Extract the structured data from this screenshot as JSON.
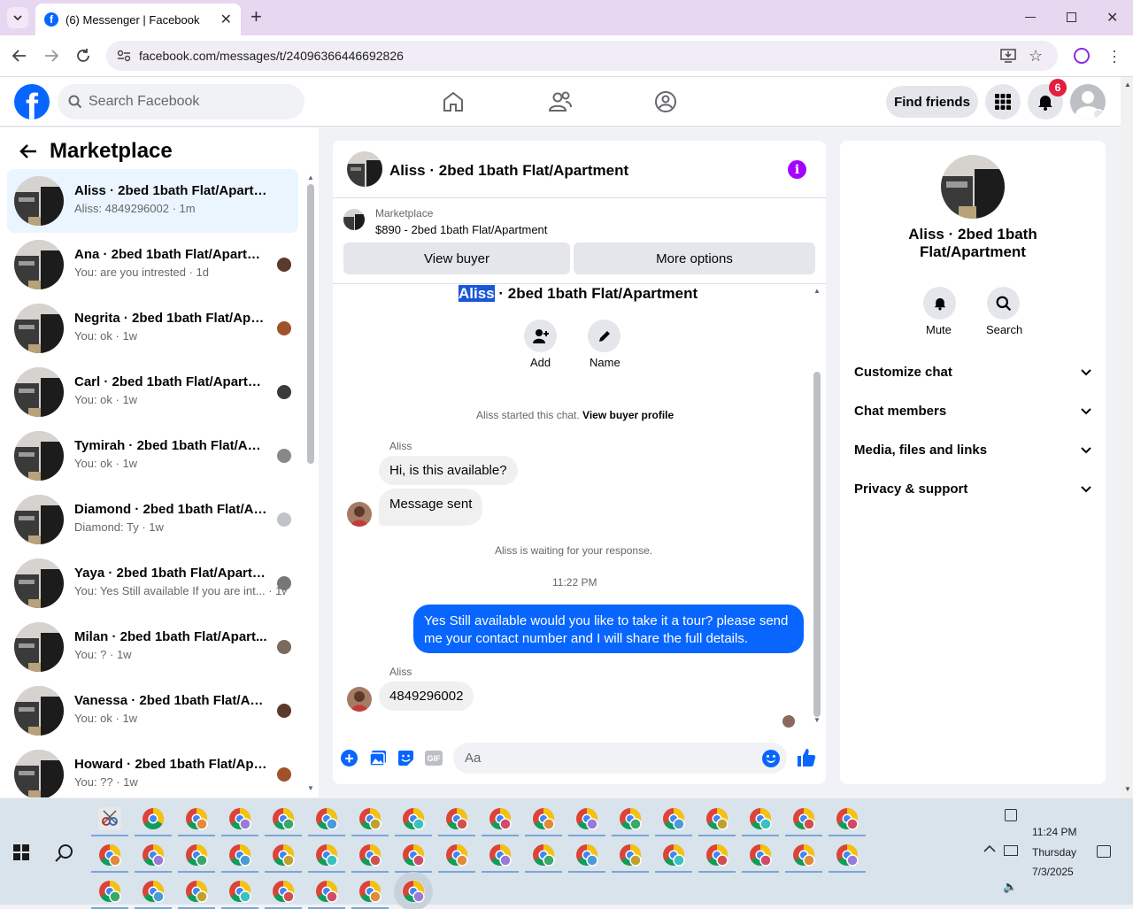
{
  "browser": {
    "tab_title": "(6) Messenger | Facebook",
    "url": "facebook.com/messages/t/24096366446692826"
  },
  "fb": {
    "search_placeholder": "Search Facebook",
    "find_friends": "Find friends",
    "notif_count": "6",
    "brand_color": "#0866ff"
  },
  "sidebar": {
    "title": "Marketplace",
    "conversations": [
      {
        "name": "Aliss · 2bed 1bath Flat/Apartment",
        "preview": "Aliss: 4849296002 · 1m"
      },
      {
        "name": "Ana · 2bed 1bath Flat/Apartm...",
        "preview": "You: are you intrested · 1d"
      },
      {
        "name": "Negrita · 2bed 1bath Flat/Apa...",
        "preview": "You: ok · 1w"
      },
      {
        "name": "Carl · 2bed 1bath Flat/Apartm...",
        "preview": "You: ok · 1w"
      },
      {
        "name": "Tymirah · 2bed 1bath Flat/Apa...",
        "preview": "You: ok · 1w"
      },
      {
        "name": "Diamond · 2bed 1bath Flat/Apar...",
        "preview": "Diamond: Ty · 1w"
      },
      {
        "name": "Yaya · 2bed 1bath Flat/Apartment",
        "preview": "You: Yes Still available If you are int... · 1w"
      },
      {
        "name": "Milan · 2bed 1bath Flat/Apart...",
        "preview": "You: ? · 1w"
      },
      {
        "name": "Vanessa · 2bed 1bath Flat/Apart...",
        "preview": "You: ok · 1w"
      },
      {
        "name": "Howard · 2bed 1bath Flat/Apart...",
        "preview": "You: ?? · 1w"
      }
    ]
  },
  "chat": {
    "header_title": "Aliss · 2bed 1bath Flat/Apartment",
    "listing_label": "Marketplace",
    "listing_title": "$890 - 2bed 1bath Flat/Apartment",
    "view_buyer": "View buyer",
    "more_options": "More options",
    "intro_name_highlight": "Aliss",
    "intro_name_rest": " · 2bed 1bath Flat/Apartment",
    "add_label": "Add",
    "name_label": "Name",
    "started_text": "Aliss started this chat. ",
    "view_profile": "View buyer profile",
    "sender1": "Aliss",
    "msg1": "Hi, is this available?",
    "msg2": "Message sent",
    "waiting": "Aliss is waiting for your response.",
    "time": "11:22 PM",
    "my_msg_line1": "Yes Still available would you like to take it a tour? please send",
    "my_msg_line2": "me your contact number and I will share the full details.",
    "sender2": "Aliss",
    "msg3": "4849296002",
    "composer_placeholder": "Aa"
  },
  "details": {
    "title_line1": "Aliss · 2bed 1bath",
    "title_line2": "Flat/Apartment",
    "mute": "Mute",
    "search": "Search",
    "sections": [
      "Customize chat",
      "Chat members",
      "Media, files and links",
      "Privacy & support"
    ]
  },
  "taskbar": {
    "time": "11:24 PM",
    "day": "Thursday",
    "date": "7/3/2025"
  }
}
